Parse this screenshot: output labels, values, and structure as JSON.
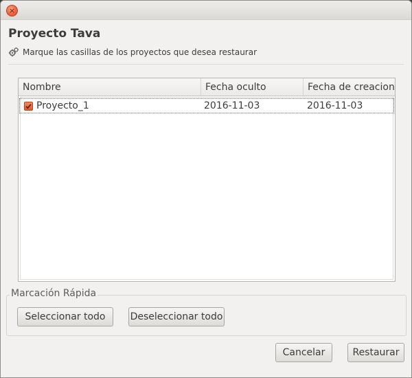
{
  "window": {
    "close_glyph": "×"
  },
  "header": {
    "title": "Proyecto Tava",
    "subtitle": "Marque las casillas de los proyectos que desea restaurar",
    "subtitle_icon": "gears-icon"
  },
  "table": {
    "columns": [
      "Nombre",
      "Fecha oculto",
      "Fecha de creacion"
    ],
    "rows": [
      {
        "checked": true,
        "name": "Proyecto_1",
        "hidden_date": "2016-11-03",
        "created_date": "2016-11-03"
      }
    ]
  },
  "quick_mark": {
    "label": "Marcación Rápida",
    "select_all": "Seleccionar todo",
    "deselect_all": "Deseleccionar todo"
  },
  "actions": {
    "cancel": "Cancelar",
    "restore": "Restaurar"
  },
  "colors": {
    "accent": "#f0623b",
    "checkbox": "#df5a2b",
    "window_bg": "#f2f1f0"
  }
}
